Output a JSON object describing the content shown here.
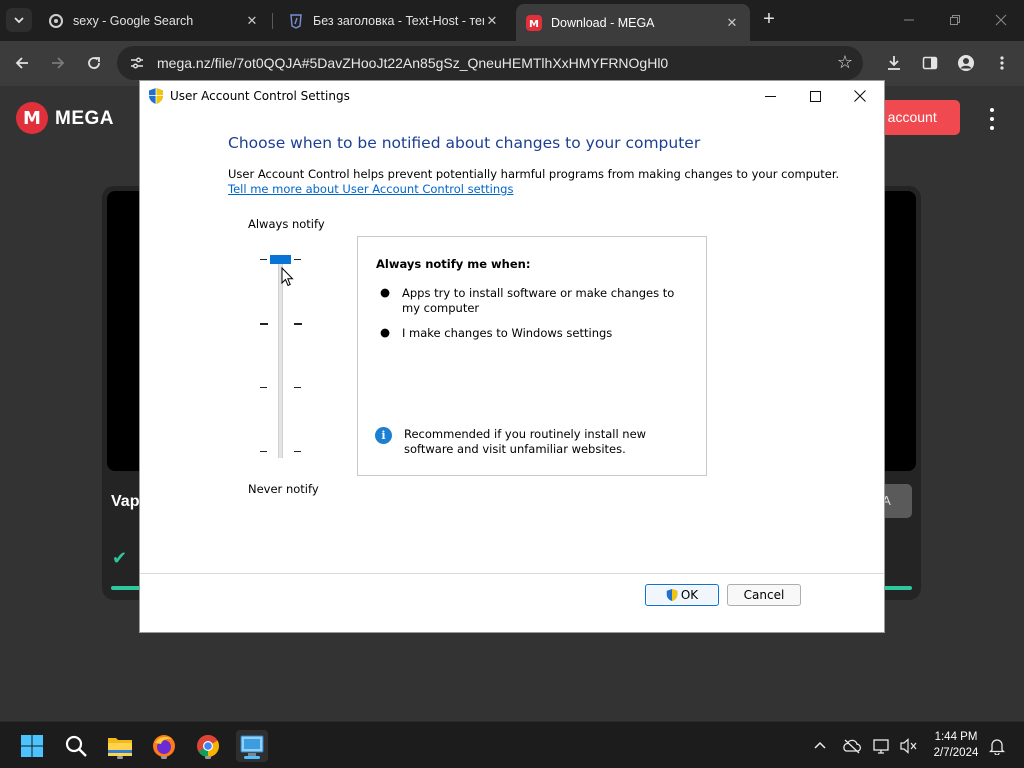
{
  "browser": {
    "tabs": [
      {
        "title": "sexy - Google Search",
        "icon": "google-lens-icon",
        "active": false
      },
      {
        "title": "Без заголовка - Text-Host - тек",
        "icon": "text-host-icon",
        "active": false
      },
      {
        "title": "Download - MEGA",
        "icon": "mega-icon",
        "active": true
      }
    ],
    "new_tab": "+",
    "url": "mega.nz/file/7ot0QQJA#5DavZHooJt22An85gSz_QneuHEMTlhXxHMYFRNOgHl0"
  },
  "mega": {
    "logo_letter": "M",
    "logo_text": "MEGA",
    "create_account": "e account",
    "file_name_partial": "Vap",
    "open_btn_partial": "GA",
    "check_mark": "✔",
    "progress": 1.0
  },
  "dialog": {
    "title": "User Account Control Settings",
    "heading": "Choose when to be notified about changes to your computer",
    "description": "User Account Control helps prevent potentially harmful programs from making changes to your computer.",
    "learn_more": "Tell me more about User Account Control settings",
    "slider": {
      "top_label": "Always notify",
      "bottom_label": "Never notify",
      "level": 4,
      "levels": 4
    },
    "info": {
      "title": "Always notify me when:",
      "bullets": [
        "Apps try to install software or make changes to my computer",
        "I make changes to Windows settings"
      ],
      "recommendation": "Recommended if you routinely install new software and visit unfamiliar websites."
    },
    "ok": "OK",
    "cancel": "Cancel"
  },
  "taskbar": {
    "apps": [
      "windows-start-icon",
      "search-icon",
      "file-explorer-icon",
      "firefox-icon",
      "chrome-icon",
      "uac-settings-app-icon"
    ],
    "time": "1:44 PM",
    "date": "2/7/2024"
  },
  "colors": {
    "accent": "#0a74d6",
    "mega_red": "#e0303c",
    "mega_button": "#f0494f",
    "heading_blue": "#1c3f95",
    "progress_green": "#2fc69e"
  }
}
